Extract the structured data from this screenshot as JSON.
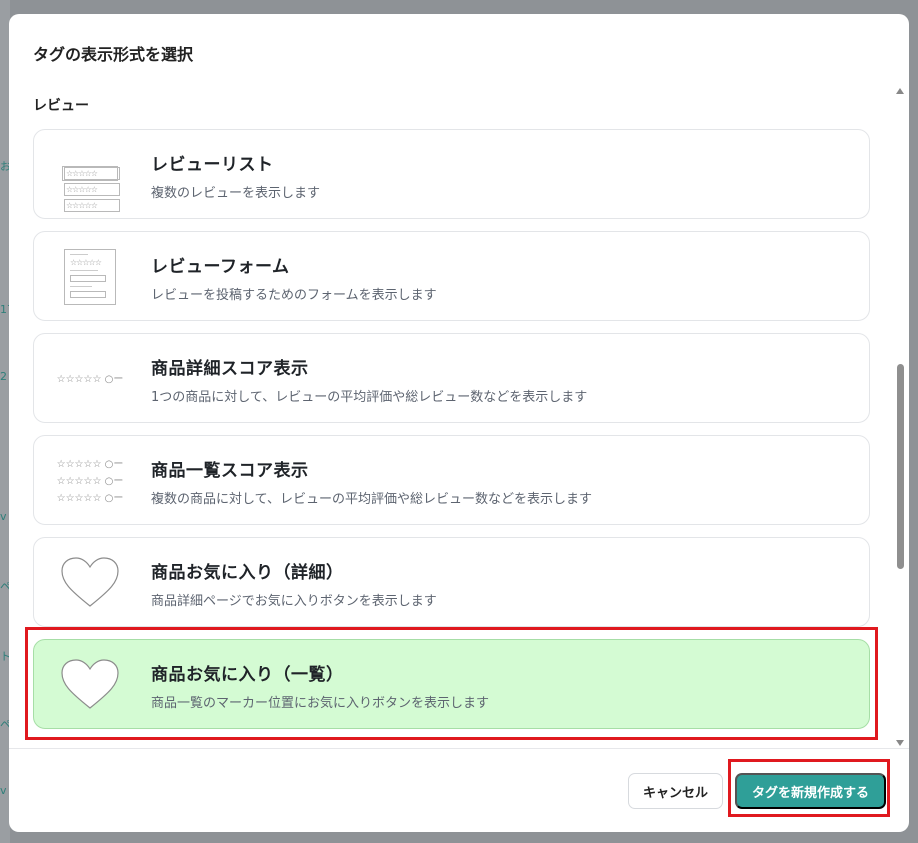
{
  "background": {
    "hints": [
      "お",
      "17",
      "2",
      "v",
      "ペ",
      "ト",
      "ペ",
      "v"
    ]
  },
  "modal": {
    "title": "タグの表示形式を選択",
    "section_label": "レビュー",
    "cards": [
      {
        "title": "レビューリスト",
        "description": "複数のレビューを表示します",
        "thumb": "review-list-thumbnail",
        "selected": false
      },
      {
        "title": "レビューフォーム",
        "description": "レビューを投稿するためのフォームを表示します",
        "thumb": "review-form-thumbnail",
        "selected": false
      },
      {
        "title": "商品詳細スコア表示",
        "description": "1つの商品に対して、レビューの平均評価や総レビュー数などを表示します",
        "thumb": "single-score-thumbnail",
        "selected": false
      },
      {
        "title": "商品一覧スコア表示",
        "description": "複数の商品に対して、レビューの平均評価や総レビュー数などを表示します",
        "thumb": "multi-score-thumbnail",
        "selected": false
      },
      {
        "title": "商品お気に入り（詳細）",
        "description": "商品詳細ページでお気に入りボタンを表示します",
        "thumb": "heart-icon",
        "selected": false
      },
      {
        "title": "商品お気に入り（一覧）",
        "description": "商品一覧のマーカー位置にお気に入りボタンを表示します",
        "thumb": "heart-icon",
        "selected": true
      }
    ],
    "thumb_text": {
      "stars": "☆☆☆☆☆",
      "score": "☆☆☆☆☆ ○ー"
    },
    "buttons": {
      "cancel": "キャンセル",
      "create": "タグを新規作成する"
    }
  },
  "colors": {
    "accent": "#2f9f98",
    "selected_bg": "#d4fbd3",
    "highlight": "#e0191f"
  }
}
